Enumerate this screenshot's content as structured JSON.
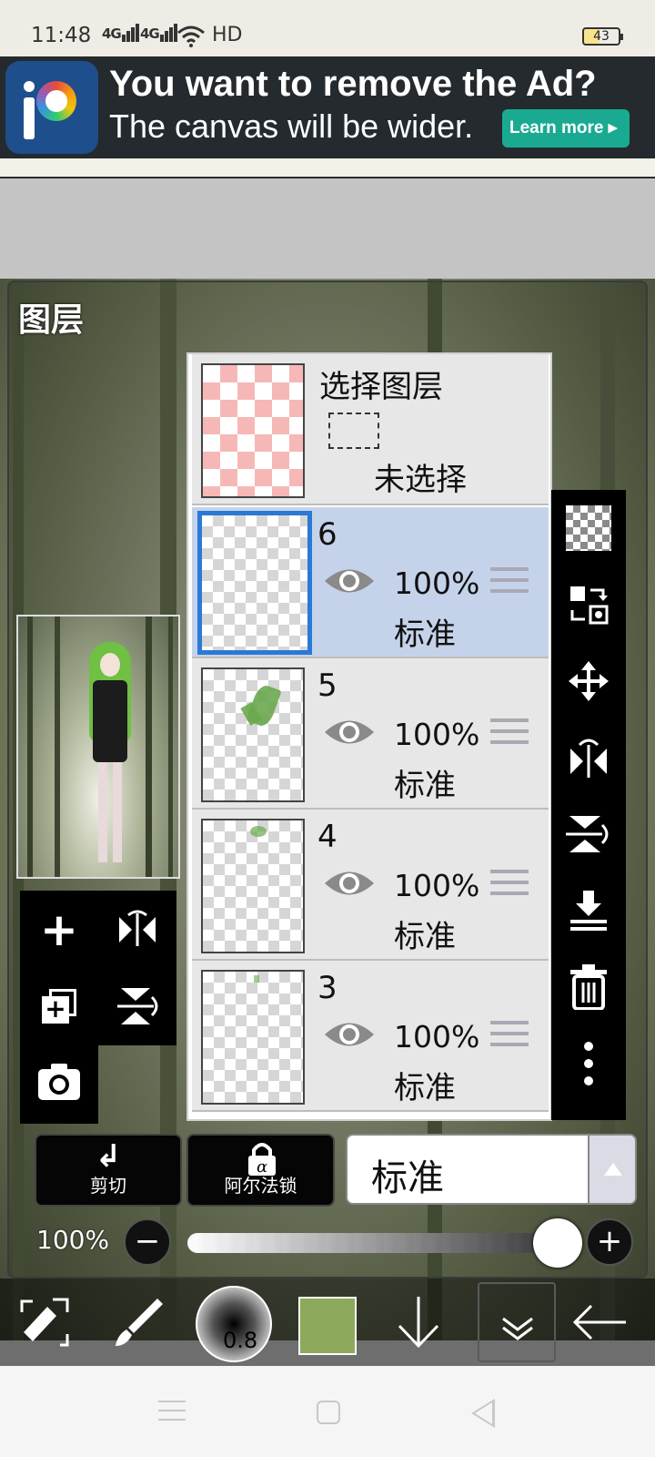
{
  "status_bar": {
    "time": "11:48",
    "signal1": "4G",
    "signal2": "4G",
    "hd": "HD",
    "battery": "43",
    "icons": [
      "signal-icon",
      "signal-icon",
      "wifi-icon",
      "battery-icon"
    ]
  },
  "ad": {
    "title": "You want to remove the Ad?",
    "subtitle": "The canvas will be wider.",
    "button": "Learn more ▸",
    "accent": "#1aaa92"
  },
  "layer_panel": {
    "title": "图层",
    "selection_layer": {
      "title": "选择图层",
      "status": "未选择"
    },
    "layers": [
      {
        "name": "6",
        "opacity": "100%",
        "blend": "标准",
        "selected": true
      },
      {
        "name": "5",
        "opacity": "100%",
        "blend": "标准",
        "selected": false
      },
      {
        "name": "4",
        "opacity": "100%",
        "blend": "标准",
        "selected": false
      },
      {
        "name": "3",
        "opacity": "100%",
        "blend": "标准",
        "selected": false
      }
    ],
    "left_tools": [
      "add-layer-icon",
      "flip-horizontal-icon",
      "duplicate-layer-icon",
      "flip-vertical-icon",
      "camera-icon"
    ],
    "right_tools": [
      "transparency-icon",
      "swap-icon",
      "move-icon",
      "flip-horizontal-icon",
      "flip-vertical-icon",
      "merge-down-icon",
      "trash-icon",
      "more-icon"
    ]
  },
  "controls": {
    "clip_label": "剪切",
    "alpha_lock_label": "阿尔法锁",
    "blend_mode": "标准",
    "opacity_label": "100%",
    "opacity_value": 1.0
  },
  "bottom_toolbar": {
    "brush_size": "0.8",
    "color": "#8da95b",
    "icons": [
      "transform-icon",
      "brush-icon",
      "brush-size-icon",
      "color-swatch",
      "arrow-down-icon",
      "layers-icon",
      "back-icon"
    ]
  },
  "nav": {
    "icons": [
      "menu-icon",
      "home-icon",
      "back-icon"
    ]
  }
}
